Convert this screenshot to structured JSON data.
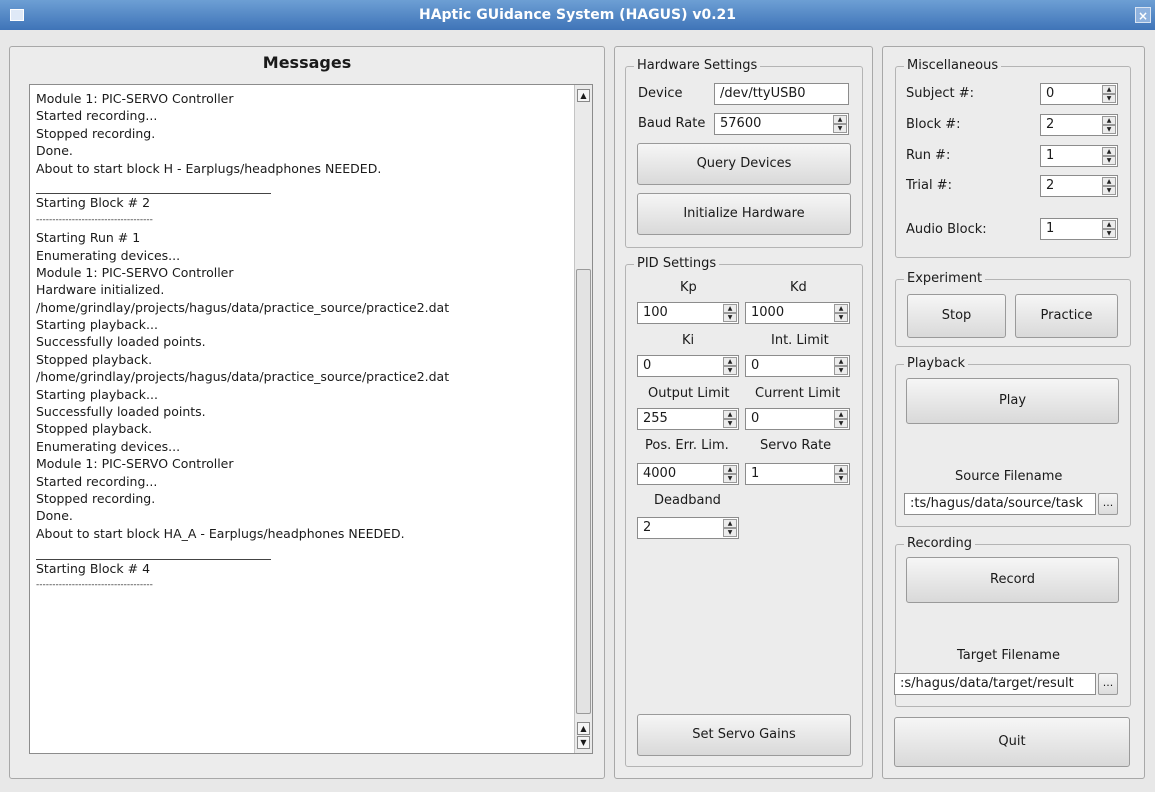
{
  "window": {
    "title": "HAptic GUidance System (HAGUS) v0.21",
    "close_glyph": "×"
  },
  "messages": {
    "title": "Messages",
    "lines": [
      {
        "text": "Module 1: PIC-SERVO Controller"
      },
      {
        "text": "Started recording..."
      },
      {
        "text": "Stopped recording."
      },
      {
        "text": "Done."
      },
      {
        "text": "About to start block H - Earplugs/headphones NEEDED."
      },
      {
        "text": "",
        "rule": "solid"
      },
      {
        "text": "Starting Block # 2"
      },
      {
        "text": "------------------------------------",
        "rule": "dash"
      },
      {
        "text": "Starting Run # 1"
      },
      {
        "text": "Enumerating devices..."
      },
      {
        "text": "Module 1: PIC-SERVO Controller"
      },
      {
        "text": "Hardware initialized."
      },
      {
        "text": "/home/grindlay/projects/hagus/data/practice_source/practice2.dat"
      },
      {
        "text": "Starting playback..."
      },
      {
        "text": "Successfully loaded points."
      },
      {
        "text": "Stopped playback."
      },
      {
        "text": "/home/grindlay/projects/hagus/data/practice_source/practice2.dat"
      },
      {
        "text": "Starting playback..."
      },
      {
        "text": "Successfully loaded points."
      },
      {
        "text": "Stopped playback."
      },
      {
        "text": "Enumerating devices..."
      },
      {
        "text": "Module 1: PIC-SERVO Controller"
      },
      {
        "text": "Started recording..."
      },
      {
        "text": "Stopped recording."
      },
      {
        "text": "Done."
      },
      {
        "text": "About to start block HA_A - Earplugs/headphones NEEDED."
      },
      {
        "text": "",
        "rule": "solid"
      },
      {
        "text": "Starting Block # 4"
      },
      {
        "text": "------------------------------------",
        "rule": "dash"
      }
    ]
  },
  "hardware": {
    "title": "Hardware Settings",
    "device_label": "Device",
    "device_value": "/dev/ttyUSB0",
    "baud_label": "Baud Rate",
    "baud_value": "57600",
    "query_button": "Query Devices",
    "init_button": "Initialize Hardware"
  },
  "pid": {
    "title": "PID Settings",
    "kp_label": "Kp",
    "kp_value": "100",
    "kd_label": "Kd",
    "kd_value": "1000",
    "ki_label": "Ki",
    "ki_value": "0",
    "int_limit_label": "Int. Limit",
    "int_limit_value": "0",
    "output_limit_label": "Output Limit",
    "output_limit_value": "255",
    "current_limit_label": "Current Limit",
    "current_limit_value": "0",
    "pos_err_label": "Pos. Err. Lim.",
    "pos_err_value": "4000",
    "servo_rate_label": "Servo Rate",
    "servo_rate_value": "1",
    "deadband_label": "Deadband",
    "deadband_value": "2",
    "set_gains_button": "Set Servo Gains"
  },
  "misc": {
    "title": "Miscellaneous",
    "subject_label": "Subject #:",
    "subject_value": "0",
    "block_label": "Block #:",
    "block_value": "2",
    "run_label": "Run #:",
    "run_value": "1",
    "trial_label": "Trial #:",
    "trial_value": "2",
    "audio_label": "Audio Block:",
    "audio_value": "1"
  },
  "experiment": {
    "title": "Experiment",
    "stop_button": "Stop",
    "practice_button": "Practice"
  },
  "playback": {
    "title": "Playback",
    "play_button": "Play",
    "source_label": "Source Filename",
    "source_value": ":ts/hagus/data/source/task",
    "browse": "..."
  },
  "recording": {
    "title": "Recording",
    "record_button": "Record",
    "target_label": "Target Filename",
    "target_value": ":s/hagus/data/target/result",
    "browse": "..."
  },
  "quit_button": "Quit",
  "colors": {
    "titlebar": "#4f84c4",
    "background": "#ececec"
  }
}
